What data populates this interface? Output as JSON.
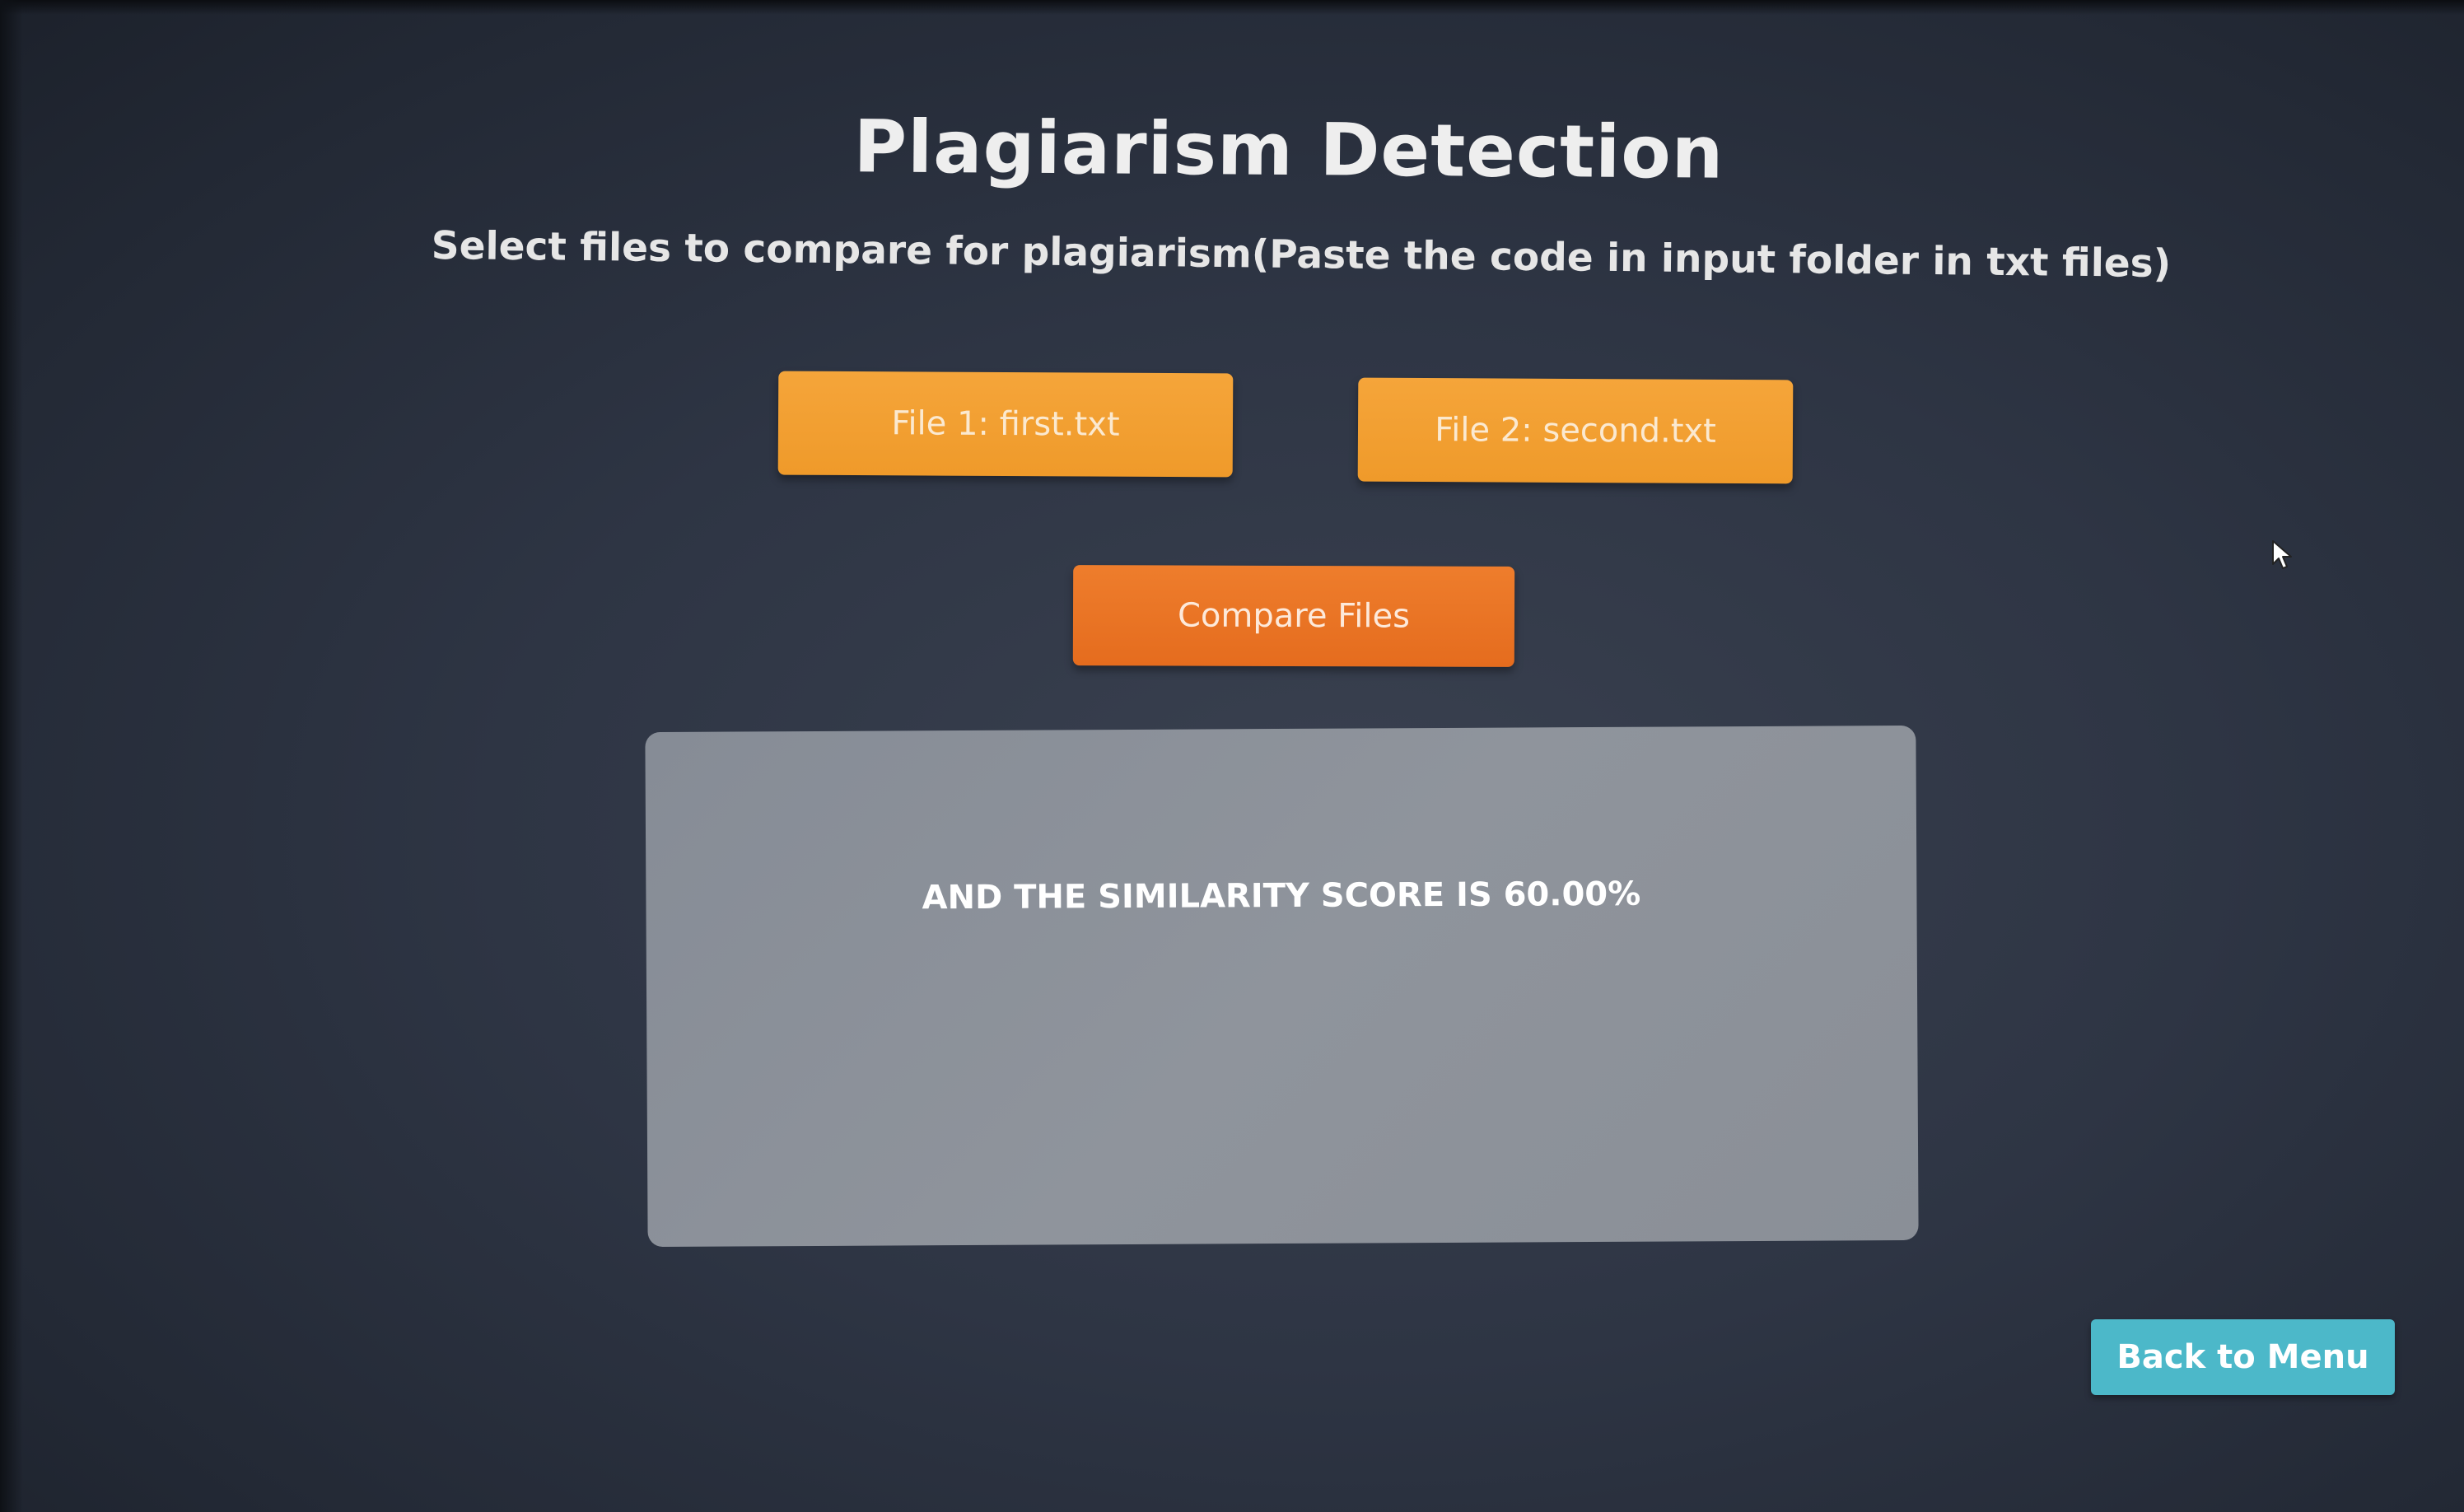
{
  "page": {
    "title": "Plagiarism Detection",
    "subtitle": "Select files to compare for plagiarism(Paste the code in input folder in txt files)"
  },
  "files": {
    "file1_label": "File 1: first.txt",
    "file2_label": "File 2: second.txt"
  },
  "actions": {
    "compare_label": "Compare Files",
    "back_label": "Back to Menu"
  },
  "result": {
    "text": "AND THE SIMILARITY SCORE IS 60.00%",
    "similarity_percent": 60.0
  },
  "colors": {
    "background": "#2e3544",
    "file_button": "#f2a032",
    "compare_button": "#e97424",
    "result_panel": "#8a8f97",
    "back_button": "#4cb8c9"
  },
  "icons": {
    "cursor": "mouse-pointer-icon"
  }
}
